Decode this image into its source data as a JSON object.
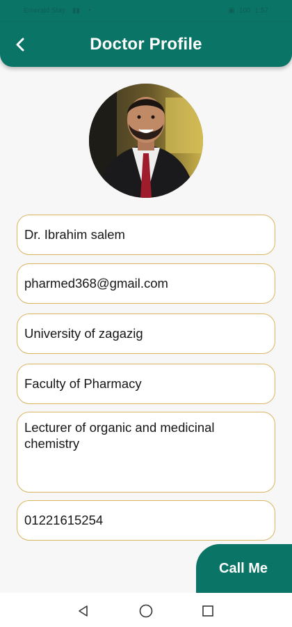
{
  "status_bar": {
    "carrier": "Emerald Stay",
    "time": "1:57",
    "battery": "100"
  },
  "header": {
    "title": "Doctor Profile",
    "back_icon": "chevron-left-icon"
  },
  "profile": {
    "name": "Dr. Ibrahim salem",
    "email": "pharmed368@gmail.com",
    "university": "University of zagazig",
    "faculty": "Faculty of Pharmacy",
    "position": "Lecturer of organic and medicinal chemistry",
    "phone": "01221615254"
  },
  "actions": {
    "call_label": "Call Me"
  },
  "nav": {
    "back_icon": "triangle-back-icon",
    "home_icon": "circle-home-icon",
    "recents_icon": "square-recents-icon"
  },
  "colors": {
    "primary": "#0a7466",
    "field_border": "#d9b560",
    "background": "#f7f7f7"
  }
}
